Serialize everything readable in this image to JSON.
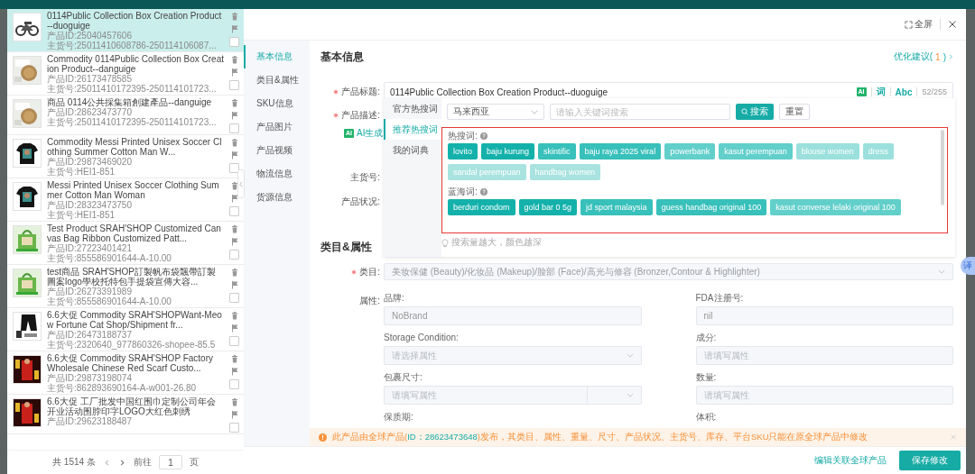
{
  "product_list": {
    "items": [
      {
        "title": "0114Public Collection Box Creation Product--duoguige",
        "product_id": "产品ID:25040457606",
        "sku": "主货号:25011410608786-250114106087...",
        "selected": true,
        "checked": false
      },
      {
        "title": "Commodity 0114Public Collection Box Creation Product--danguige",
        "product_id": "产品ID:26173478585",
        "sku": "主货号:25011410172395-250114101723...",
        "selected": false,
        "checked": false
      },
      {
        "title": "商品 0114公共採集箱創建產品--danguige",
        "product_id": "产品ID:28623473770",
        "sku": "主货号:25011410172395-250114101723...",
        "selected": false,
        "checked": false
      },
      {
        "title": "Commodity Messi Printed Unisex Soccer Clothing Summer Cotton Man W...",
        "product_id": "产品ID:29873469020",
        "sku": "主货号:HEI1-851",
        "selected": false,
        "checked": false
      },
      {
        "title": "Messi Printed Unisex Soccer Clothing Summer Cotton Man Woman",
        "product_id": "产品ID:28323473750",
        "sku": "主货号:HEI1-851",
        "selected": false,
        "checked": false
      },
      {
        "title": "Test Product SRAH'SHOP Customized Canvas Bag Ribbon Customized Patt...",
        "product_id": "产品ID:27223401421",
        "sku": "主货号:855586901644-A-10.00",
        "selected": false,
        "checked": false
      },
      {
        "title": "test商品 SRAH'SHOP訂製帆布袋飄帶訂製圖案logo學校托特包手提袋宣傳大容...",
        "product_id": "产品ID:26273391989",
        "sku": "主货号:855586901644-A-10.00",
        "selected": false,
        "checked": false
      },
      {
        "title": "6.6大促 Commodity SRAH'SHOPWant-Meow Fortune Cat Shop/Shipment fr...",
        "product_id": "产品ID:26473188737",
        "sku": "主货号:2320640_977860326-shopee-85.5",
        "selected": false,
        "checked": false
      },
      {
        "title": "6.6大促 Commodity SRAH'SHOP Factory Wholesale Chinese Red Scarf Custo...",
        "product_id": "产品ID:29873198074",
        "sku": "主货号:862893690164-A-w001-26.80",
        "selected": false,
        "checked": false
      },
      {
        "title": "6.6大促 工厂批发中国红围巾定制公司年会开业活动围脖印字LOGO大红色刺绣",
        "product_id": "产品ID:29623188487",
        "selected": false,
        "checked": false
      }
    ],
    "pagination": {
      "total": "共 1514 条",
      "goto": "前往",
      "page": "1",
      "page_unit": "页"
    }
  },
  "modal": {
    "fullscreen": "全屏"
  },
  "nav": [
    {
      "label": "基本信息",
      "selected": true
    },
    {
      "label": "类目&属性",
      "selected": false
    },
    {
      "label": "SKU信息",
      "selected": false
    },
    {
      "label": "产品图片",
      "selected": false
    },
    {
      "label": "产品视频",
      "selected": false
    },
    {
      "label": "物流信息",
      "selected": false
    },
    {
      "label": "货源信息",
      "selected": false
    }
  ],
  "basic_info": {
    "title": "基本信息",
    "suggestion": {
      "before": "优化建议(",
      "count": "1",
      "after": ")"
    },
    "product_title": {
      "label": "产品标题:",
      "required": true,
      "value": "0114Public Collection Box Creation Product--duoguige",
      "ai_badge": "AI",
      "tools": [
        "词",
        "Abc"
      ],
      "counter": "52/255"
    },
    "description": {
      "label": "产品描述:",
      "required": true,
      "ai_badge": "AI",
      "ai_link": "AI生成"
    },
    "sku_label": "主货号:",
    "condition_label": "产品状况:"
  },
  "hot_words_popup": {
    "tabs": [
      {
        "label": "官方热搜词",
        "selected": false
      },
      {
        "label": "推荐热搜词",
        "selected": true
      },
      {
        "label": "我的词典",
        "selected": false
      }
    ],
    "region": "马来西亚",
    "search_placeholder": "请输入关键词搜索",
    "search_button": "搜索",
    "reset_button": "重置",
    "groups": [
      {
        "title": "热搜词:",
        "tags": [
          {
            "text": "lovito",
            "color": "#14b1ab"
          },
          {
            "text": "baju kurung",
            "color": "#14b1ab"
          },
          {
            "text": "skintific",
            "color": "#38c0bb"
          },
          {
            "text": "baju raya 2025 viral",
            "color": "#38c0bb"
          },
          {
            "text": "powerbank",
            "color": "#62cfca"
          },
          {
            "text": "kasut perempuan",
            "color": "#62cfca"
          },
          {
            "text": "blouse women",
            "color": "#9be0dc"
          },
          {
            "text": "dress",
            "color": "#9be0dc"
          },
          {
            "text": "sandal perempuan",
            "color": "#a9e3e0"
          },
          {
            "text": "handbag women",
            "color": "#a9e3e0"
          }
        ]
      },
      {
        "title": "蓝海词:",
        "tags": [
          {
            "text": "berduri condom",
            "color": "#14b1ab"
          },
          {
            "text": "gold bar 0 5g",
            "color": "#14b1ab"
          },
          {
            "text": "jd sport malaysia",
            "color": "#38c0bb"
          },
          {
            "text": "guess handbag original 100",
            "color": "#38c0bb"
          },
          {
            "text": "kasut converse lelaki original 100",
            "color": "#62cfca"
          }
        ]
      }
    ],
    "hint": "搜索量越大，颜色越深"
  },
  "category_section": {
    "title": "类目&属性",
    "category": {
      "label": "类目:",
      "required": true,
      "value": "美妆保健 (Beauty)/化妆品 (Makeup)/脸部 (Face)/高光与修容 (Bronzer,Contour & Highlighter)"
    },
    "attributes_label": "属性:",
    "attributes": [
      {
        "label": "品牌:",
        "kind": "input",
        "value": "NoBrand"
      },
      {
        "label": "FDA注册号:",
        "kind": "input",
        "value": "nil"
      },
      {
        "label": "Storage Condition:",
        "kind": "select",
        "placeholder": "请选择属性"
      },
      {
        "label": "成分:",
        "kind": "input",
        "placeholder": "请填写属性"
      },
      {
        "label": "包裹尺寸:",
        "kind": "input_unit",
        "placeholder": "请填写属性"
      },
      {
        "label": "数量:",
        "kind": "input",
        "placeholder": "请填写属性"
      },
      {
        "label": "保质期:",
        "kind": "label"
      },
      {
        "label": "体积:",
        "kind": "label"
      }
    ]
  },
  "notice": {
    "before": "此产品由全球产品(",
    "link": "ID：28623473648",
    "after": ")发布，其类目、属性、重量、尺寸、产品状况、主货号、库存、平台SKU只能在原全球产品中修改"
  },
  "footer": {
    "link": "编辑关联全球产品",
    "save": "保存修改"
  },
  "translate_badge": "译"
}
